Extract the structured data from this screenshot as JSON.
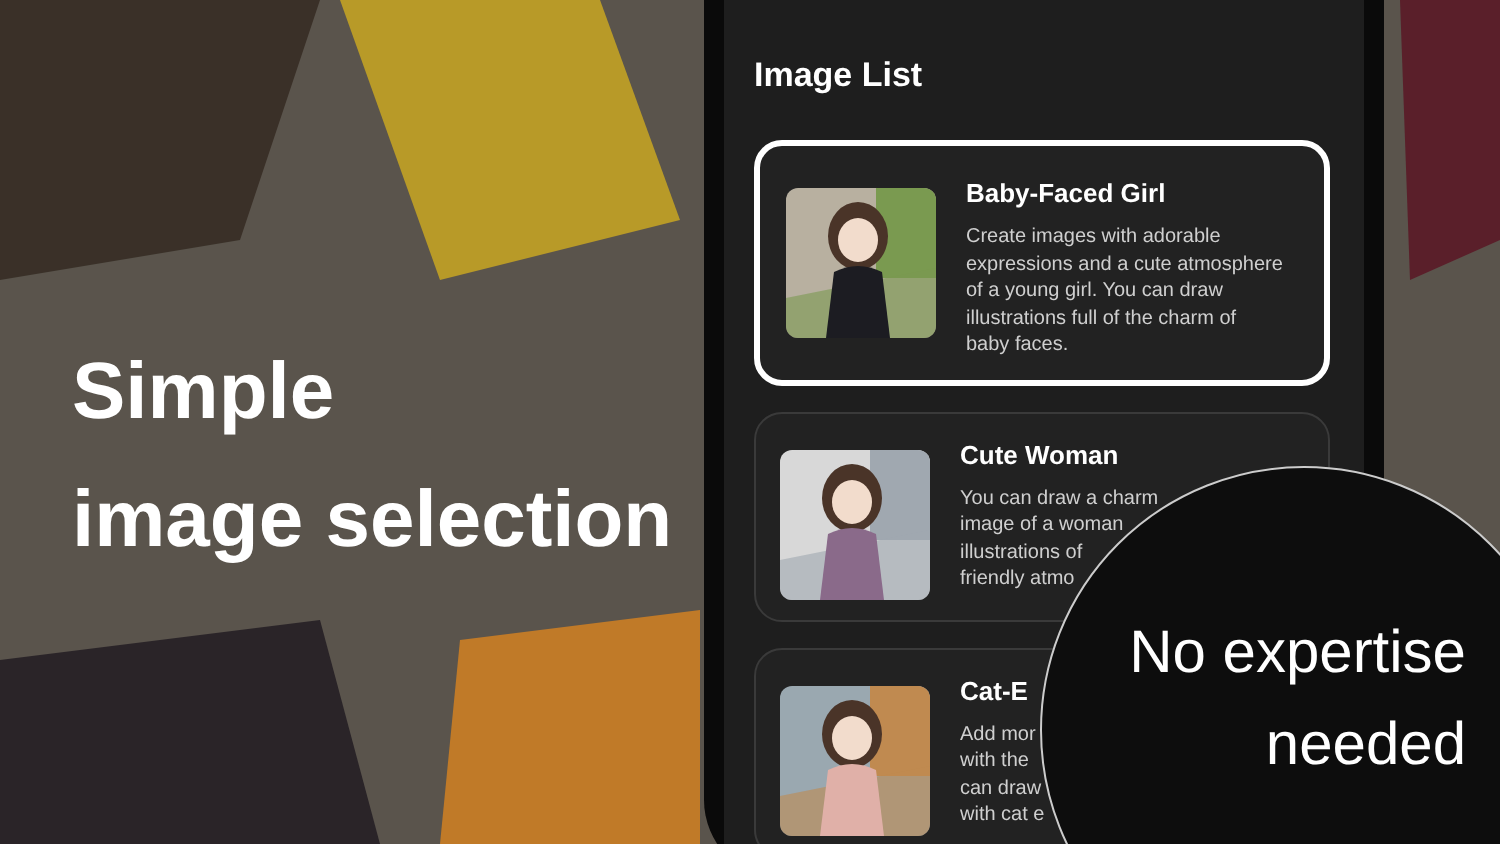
{
  "headline": [
    "Simple",
    "image selection"
  ],
  "screen": {
    "title": "Image List",
    "cards": [
      {
        "title": "Baby-Faced Girl",
        "selected": true,
        "lines": [
          "Create images with adorable",
          "expressions and a cute atmosphere",
          "of a young girl. You can draw",
          "illustrations full of the charm of",
          "baby faces."
        ]
      },
      {
        "title": "Cute Woman",
        "selected": false,
        "lines": [
          "You can draw a charm",
          "image of a woman",
          "illustrations of",
          "friendly atmo"
        ]
      },
      {
        "title": "Cat-E",
        "selected": false,
        "lines": [
          "Add mor",
          "with the",
          "can draw",
          "with cat e"
        ]
      }
    ]
  },
  "callout": [
    "No expertise",
    "needed"
  ]
}
